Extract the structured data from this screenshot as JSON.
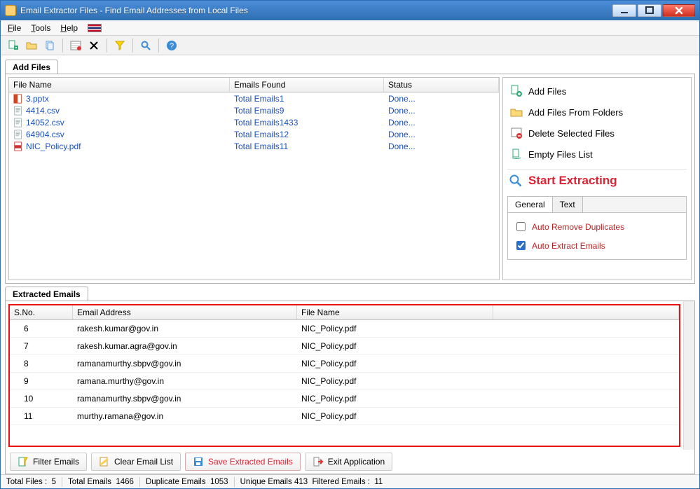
{
  "window": {
    "title": "Email Extractor Files -   Find Email Addresses from Local Files"
  },
  "menu": {
    "file": "File",
    "tools": "Tools",
    "help": "Help"
  },
  "tabs": {
    "addFiles": "Add Files",
    "extracted": "Extracted Emails"
  },
  "filesGrid": {
    "cols": {
      "name": "File Name",
      "emails": "Emails Found",
      "status": "Status"
    },
    "rows": [
      {
        "icon": "ppt",
        "name": "3.pptx",
        "emails": "Total Emails1",
        "status": "Done..."
      },
      {
        "icon": "doc",
        "name": "4414.csv",
        "emails": "Total Emails9",
        "status": "Done..."
      },
      {
        "icon": "doc",
        "name": "14052.csv",
        "emails": "Total Emails1433",
        "status": "Done..."
      },
      {
        "icon": "doc",
        "name": "64904.csv",
        "emails": "Total Emails12",
        "status": "Done..."
      },
      {
        "icon": "pdf",
        "name": "NIC_Policy.pdf",
        "emails": "Total Emails11",
        "status": "Done..."
      }
    ]
  },
  "side": {
    "addFiles": "Add Files",
    "addFolders": "Add Files From Folders",
    "deleteSel": "Delete Selected Files",
    "empty": "Empty Files List",
    "start": "Start Extracting",
    "tabs": {
      "general": "General",
      "text": "Text"
    },
    "opts": {
      "autoRemoveDup": "Auto Remove Duplicates",
      "autoExtract": "Auto Extract Emails"
    }
  },
  "extractedGrid": {
    "cols": {
      "sno": "S.No.",
      "email": "Email Address",
      "file": "File Name"
    },
    "rows": [
      {
        "sno": "6",
        "email": "rakesh.kumar@gov.in",
        "file": "NIC_Policy.pdf"
      },
      {
        "sno": "7",
        "email": "rakesh.kumar.agra@gov.in",
        "file": "NIC_Policy.pdf"
      },
      {
        "sno": "8",
        "email": "ramanamurthy.sbpv@gov.in",
        "file": "NIC_Policy.pdf"
      },
      {
        "sno": "9",
        "email": "ramana.murthy@gov.in",
        "file": "NIC_Policy.pdf"
      },
      {
        "sno": "10",
        "email": "ramanamurthy.sbpv@gov.in",
        "file": "NIC_Policy.pdf"
      },
      {
        "sno": "11",
        "email": "murthy.ramana@gov.in",
        "file": "NIC_Policy.pdf"
      }
    ]
  },
  "btnbar": {
    "filter": "Filter Emails",
    "clear": "Clear Email List",
    "save": "Save Extracted Emails",
    "exit": "Exit Application"
  },
  "status": {
    "totalFilesLbl": "Total Files :",
    "totalFiles": "5",
    "totalEmailsLbl": "Total Emails",
    "totalEmails": "1466",
    "dupLbl": "Duplicate Emails",
    "dup": "1053",
    "uniqueLbl": "Unique Emails",
    "unique": "413",
    "filteredLbl": "Filtered Emails :",
    "filtered": "11"
  }
}
